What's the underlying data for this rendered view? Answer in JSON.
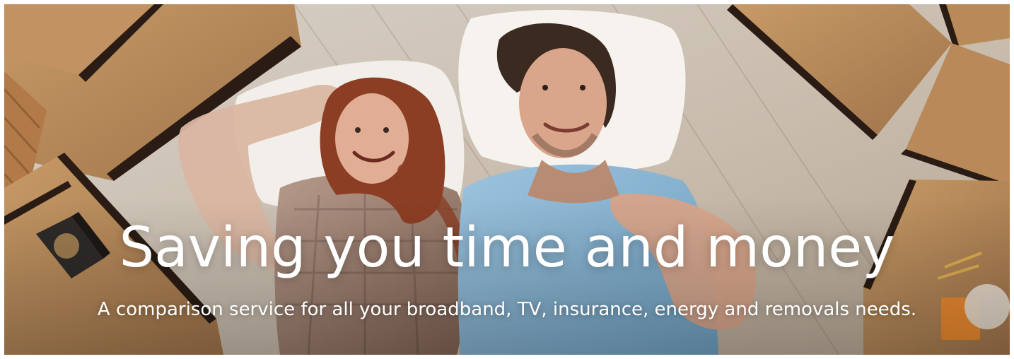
{
  "hero": {
    "headline": "Saving you time and money",
    "subhead": "A comparison service for all your broadband, TV, insurance, energy and removals needs.",
    "image": {
      "subject": "couple-lying-on-floor-among-moving-boxes",
      "colors": {
        "floor": "#b8a893",
        "box": "#b88a58",
        "box_edge": "#2a1c14",
        "pillow": "#f2eee9",
        "man_shirt": "#7aa8c9",
        "woman_shirt": "#9b7d6a",
        "skin": "#d7a48a",
        "hair_red": "#8b3e24",
        "hair_dark": "#3b2a20"
      }
    }
  }
}
